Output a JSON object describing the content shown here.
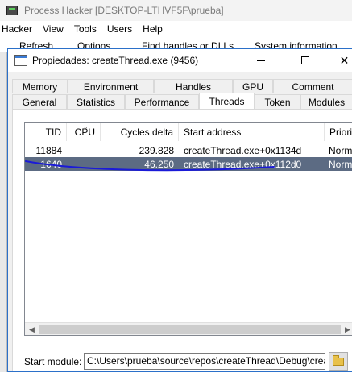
{
  "background_app": {
    "title": "Process Hacker [DESKTOP-LTHVF5F\\prueba]",
    "menu": [
      "Hacker",
      "View",
      "Tools",
      "Users",
      "Help"
    ],
    "toolbar": [
      "Refresh",
      "Options",
      "Find handles or DLLs",
      "System information"
    ]
  },
  "dialog": {
    "title": "Propiedades: createThread.exe (9456)",
    "tabs_row1": [
      "Memory",
      "Environment",
      "Handles",
      "GPU",
      "Comment"
    ],
    "tabs_row2": [
      "General",
      "Statistics",
      "Performance",
      "Threads",
      "Token",
      "Modules"
    ],
    "active_tab": "Threads"
  },
  "threads": {
    "columns": [
      "TID",
      "CPU",
      "Cycles delta",
      "Start address",
      "Priority"
    ],
    "rows": [
      {
        "tid": "11884",
        "cpu": "",
        "cycles": "239.828",
        "start": "createThread.exe+0x1134d",
        "priority": "Normal",
        "selected": false
      },
      {
        "tid": "1640",
        "cpu": "",
        "cycles": "46.250",
        "start": "createThread.exe+0x112d0",
        "priority": "Normal",
        "selected": true
      }
    ]
  },
  "start_module": {
    "label": "Start module:",
    "value": "C:\\Users\\prueba\\source\\repos\\createThread\\Debug\\createThread.exe"
  },
  "colors": {
    "selection": "#5c6b83",
    "dialog_border": "#2b70c9",
    "annotation_ink": "#1a1ad8"
  },
  "icons": [
    "app-icon",
    "dialog-icon",
    "minimize-icon",
    "maximize-icon",
    "close-icon",
    "folder-icon",
    "scroll-left-icon",
    "scroll-right-icon",
    "sort-indicator-icon"
  ]
}
